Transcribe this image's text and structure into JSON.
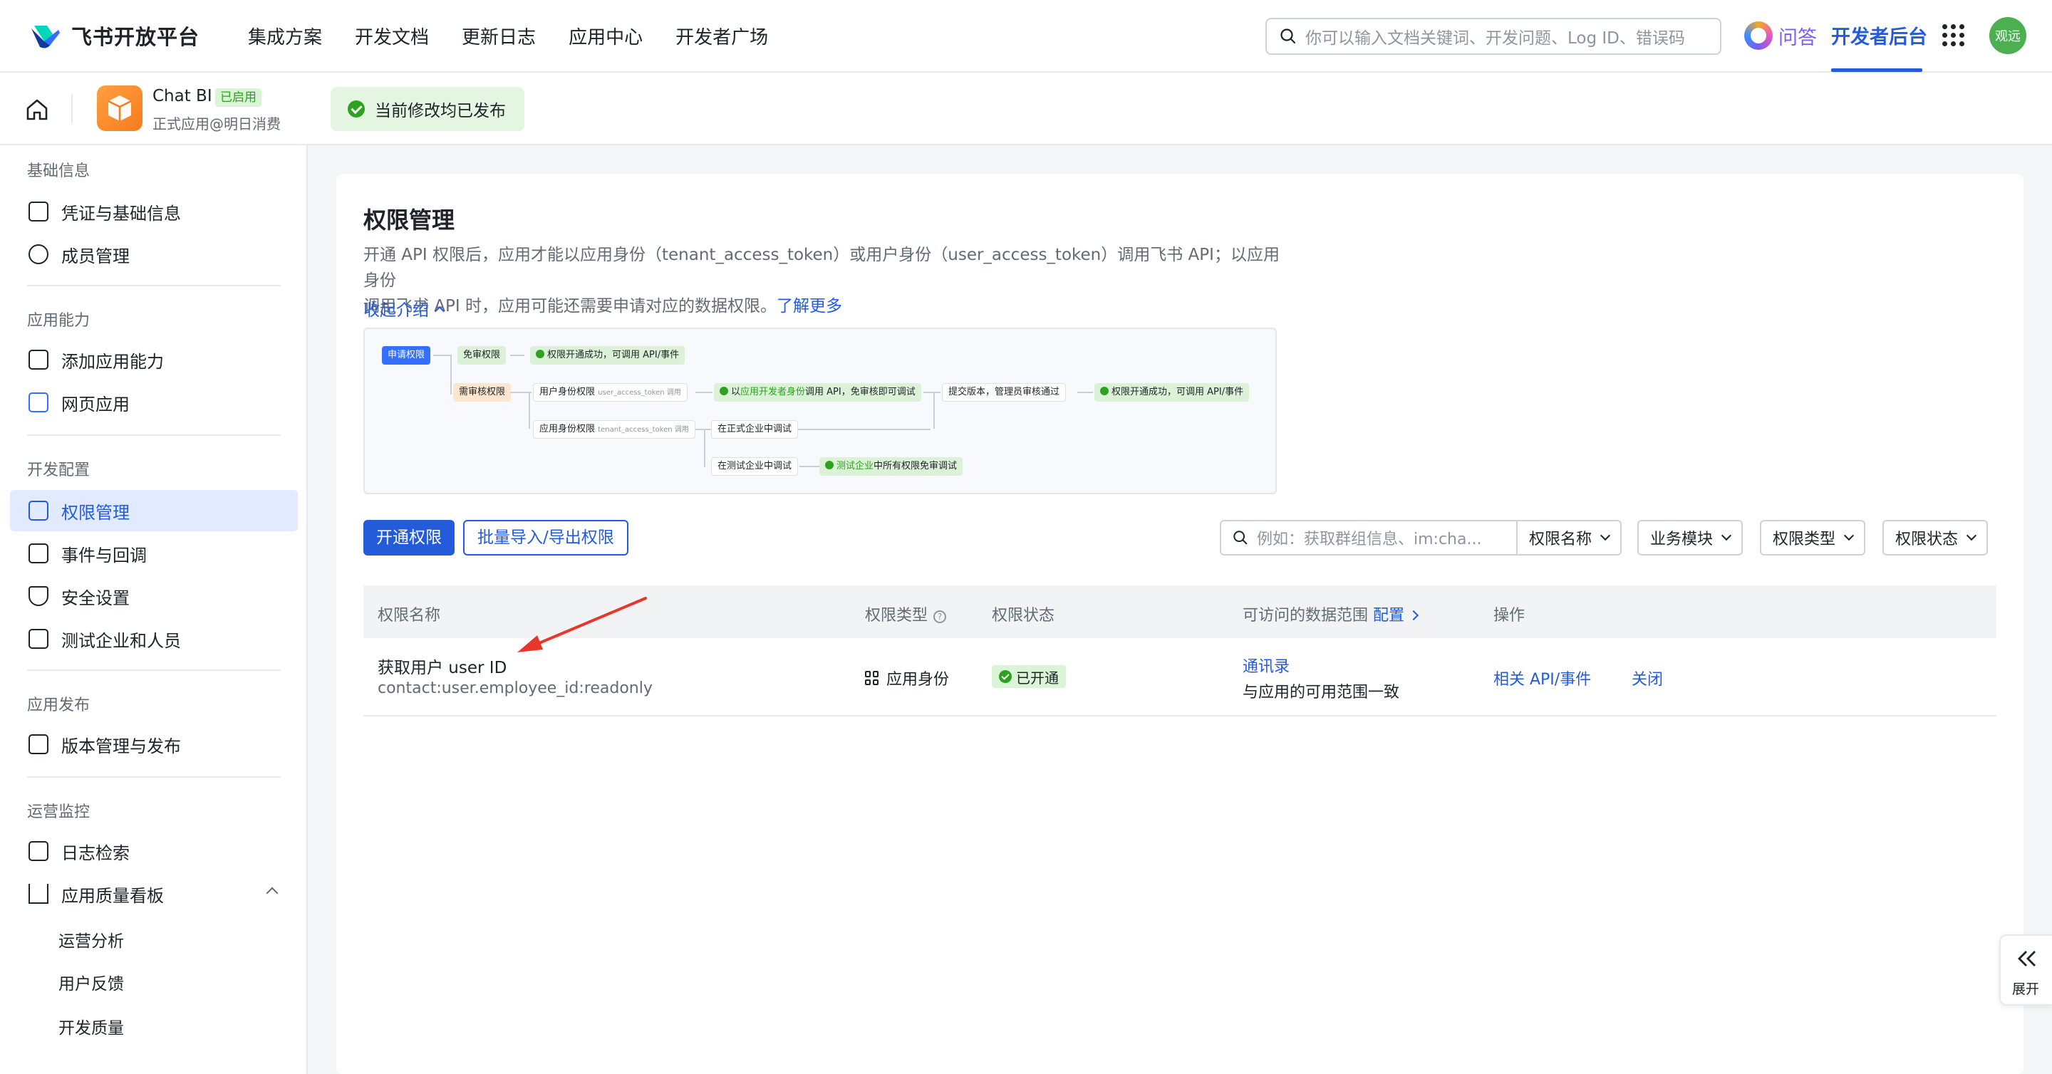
{
  "topnav": {
    "brand": "飞书开放平台",
    "links": [
      "集成方案",
      "开发文档",
      "更新日志",
      "应用中心",
      "开发者广场"
    ],
    "search_placeholder": "你可以输入文档关键词、开发问题、Log ID、错误码",
    "qa_label": "问答",
    "dev_backend": "开发者后台",
    "avatar_text": "观远",
    "avatar_color": "#4caf50"
  },
  "appbar": {
    "app_name": "Chat BI",
    "app_badge": "已启用",
    "app_subtitle": "正式应用@明日消费",
    "publish_status": "当前修改均已发布"
  },
  "sidebar": {
    "groups": [
      {
        "title": "基础信息",
        "items": [
          "凭证与基础信息",
          "成员管理"
        ]
      },
      {
        "title": "应用能力",
        "items": [
          "添加应用能力",
          "网页应用"
        ]
      },
      {
        "title": "开发配置",
        "items": [
          "权限管理",
          "事件与回调",
          "安全设置",
          "测试企业和人员"
        ]
      },
      {
        "title": "应用发布",
        "items": [
          "版本管理与发布"
        ]
      },
      {
        "title": "运营监控",
        "items": [
          "日志检索",
          "应用质量看板"
        ]
      }
    ],
    "sub_items": [
      "运营分析",
      "用户反馈",
      "开发质量"
    ],
    "active_item": "权限管理"
  },
  "main": {
    "title": "权限管理",
    "desc_1": "开通 API 权限后，应用才能以应用身份（tenant_access_token）或用户身份（user_access_token）调用飞书 API；以应用身份",
    "desc_2": "调用飞书 API 时，应用可能还需要申请对应的数据权限。",
    "learn_more": "了解更多",
    "collapse_label": "收起介绍",
    "flow": {
      "apply": "申请权限",
      "no_review": "免审权限",
      "success_1": "权限开通成功，可调用 API/事件",
      "need_review": "需审核权限",
      "user_perm": "用户身份权限",
      "user_token": "user_access_token 调用",
      "dev_identity_1": "以",
      "dev_identity_2": "应用开发者身份",
      "dev_identity_3": "调用 API，免审核即可调试",
      "submit": "提交版本，管理员审核通过",
      "success_2": "权限开通成功，可调用 API/事件",
      "app_perm": "应用身份权限",
      "tenant_token": "tenant_access_token 调用",
      "prod_debug": "在正式企业中调试",
      "test_debug": "在测试企业中调试",
      "test_free_1": "测试企业",
      "test_free_2": "中所有权限免审调试"
    },
    "btn_enable": "开通权限",
    "btn_batch": "批量导入/导出权限",
    "filter_placeholder": "例如：获取群组信息、im:cha...",
    "filters": [
      "权限名称",
      "业务模块",
      "权限类型",
      "权限状态"
    ],
    "table": {
      "headers": {
        "name": "权限名称",
        "type": "权限类型",
        "status": "权限状态",
        "scope": "可访问的数据范围",
        "scope_link": "配置",
        "ops": "操作"
      },
      "rows": [
        {
          "name": "获取用户 user ID",
          "key": "contact:user.employee_id:readonly",
          "type": "应用身份",
          "status": "已开通",
          "scope_link": "通讯录",
          "scope_text": "与应用的可用范围一致",
          "op_api": "相关 API/事件",
          "op_close": "关闭"
        }
      ]
    }
  },
  "expand_label": "展开",
  "colors": {
    "accent": "#245bdb",
    "success": "#2ea121",
    "annotation_arrow": "#e8362b"
  }
}
